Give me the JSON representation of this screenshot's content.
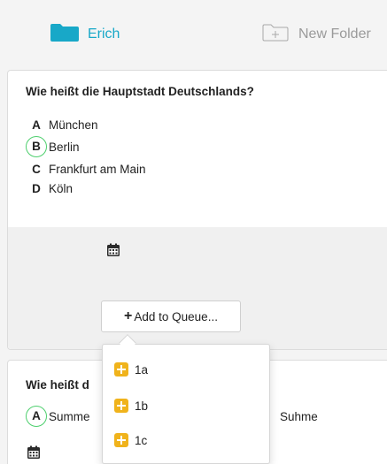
{
  "folders": [
    {
      "label": "Erich",
      "icon": "folder-icon",
      "color": "#18a8c8"
    },
    {
      "label": "New Folder",
      "icon": "new-folder-icon",
      "color": "#9a9a9a"
    }
  ],
  "questions": [
    {
      "title": "Wie heißt die Hauptstadt Deutschlands?",
      "answers": [
        {
          "letter": "A",
          "text": "München"
        },
        {
          "letter": "B",
          "text": "Berlin",
          "correct": true
        },
        {
          "letter": "C",
          "text": "Frankfurt am Main"
        },
        {
          "letter": "D",
          "text": "Köln"
        }
      ],
      "add_queue_label": "Add to Queue..."
    },
    {
      "title": "Wie heißt d",
      "answers": [
        {
          "letter": "A",
          "text": "Summe",
          "correct": true
        }
      ],
      "extra_answer_text": "Suhme"
    }
  ],
  "queue_dropdown": {
    "items": [
      "1a",
      "1b",
      "1c"
    ]
  },
  "colors": {
    "accent": "#18a8c8",
    "correct_ring": "#4dcf6d",
    "queue_plus": "#f0b31c"
  }
}
